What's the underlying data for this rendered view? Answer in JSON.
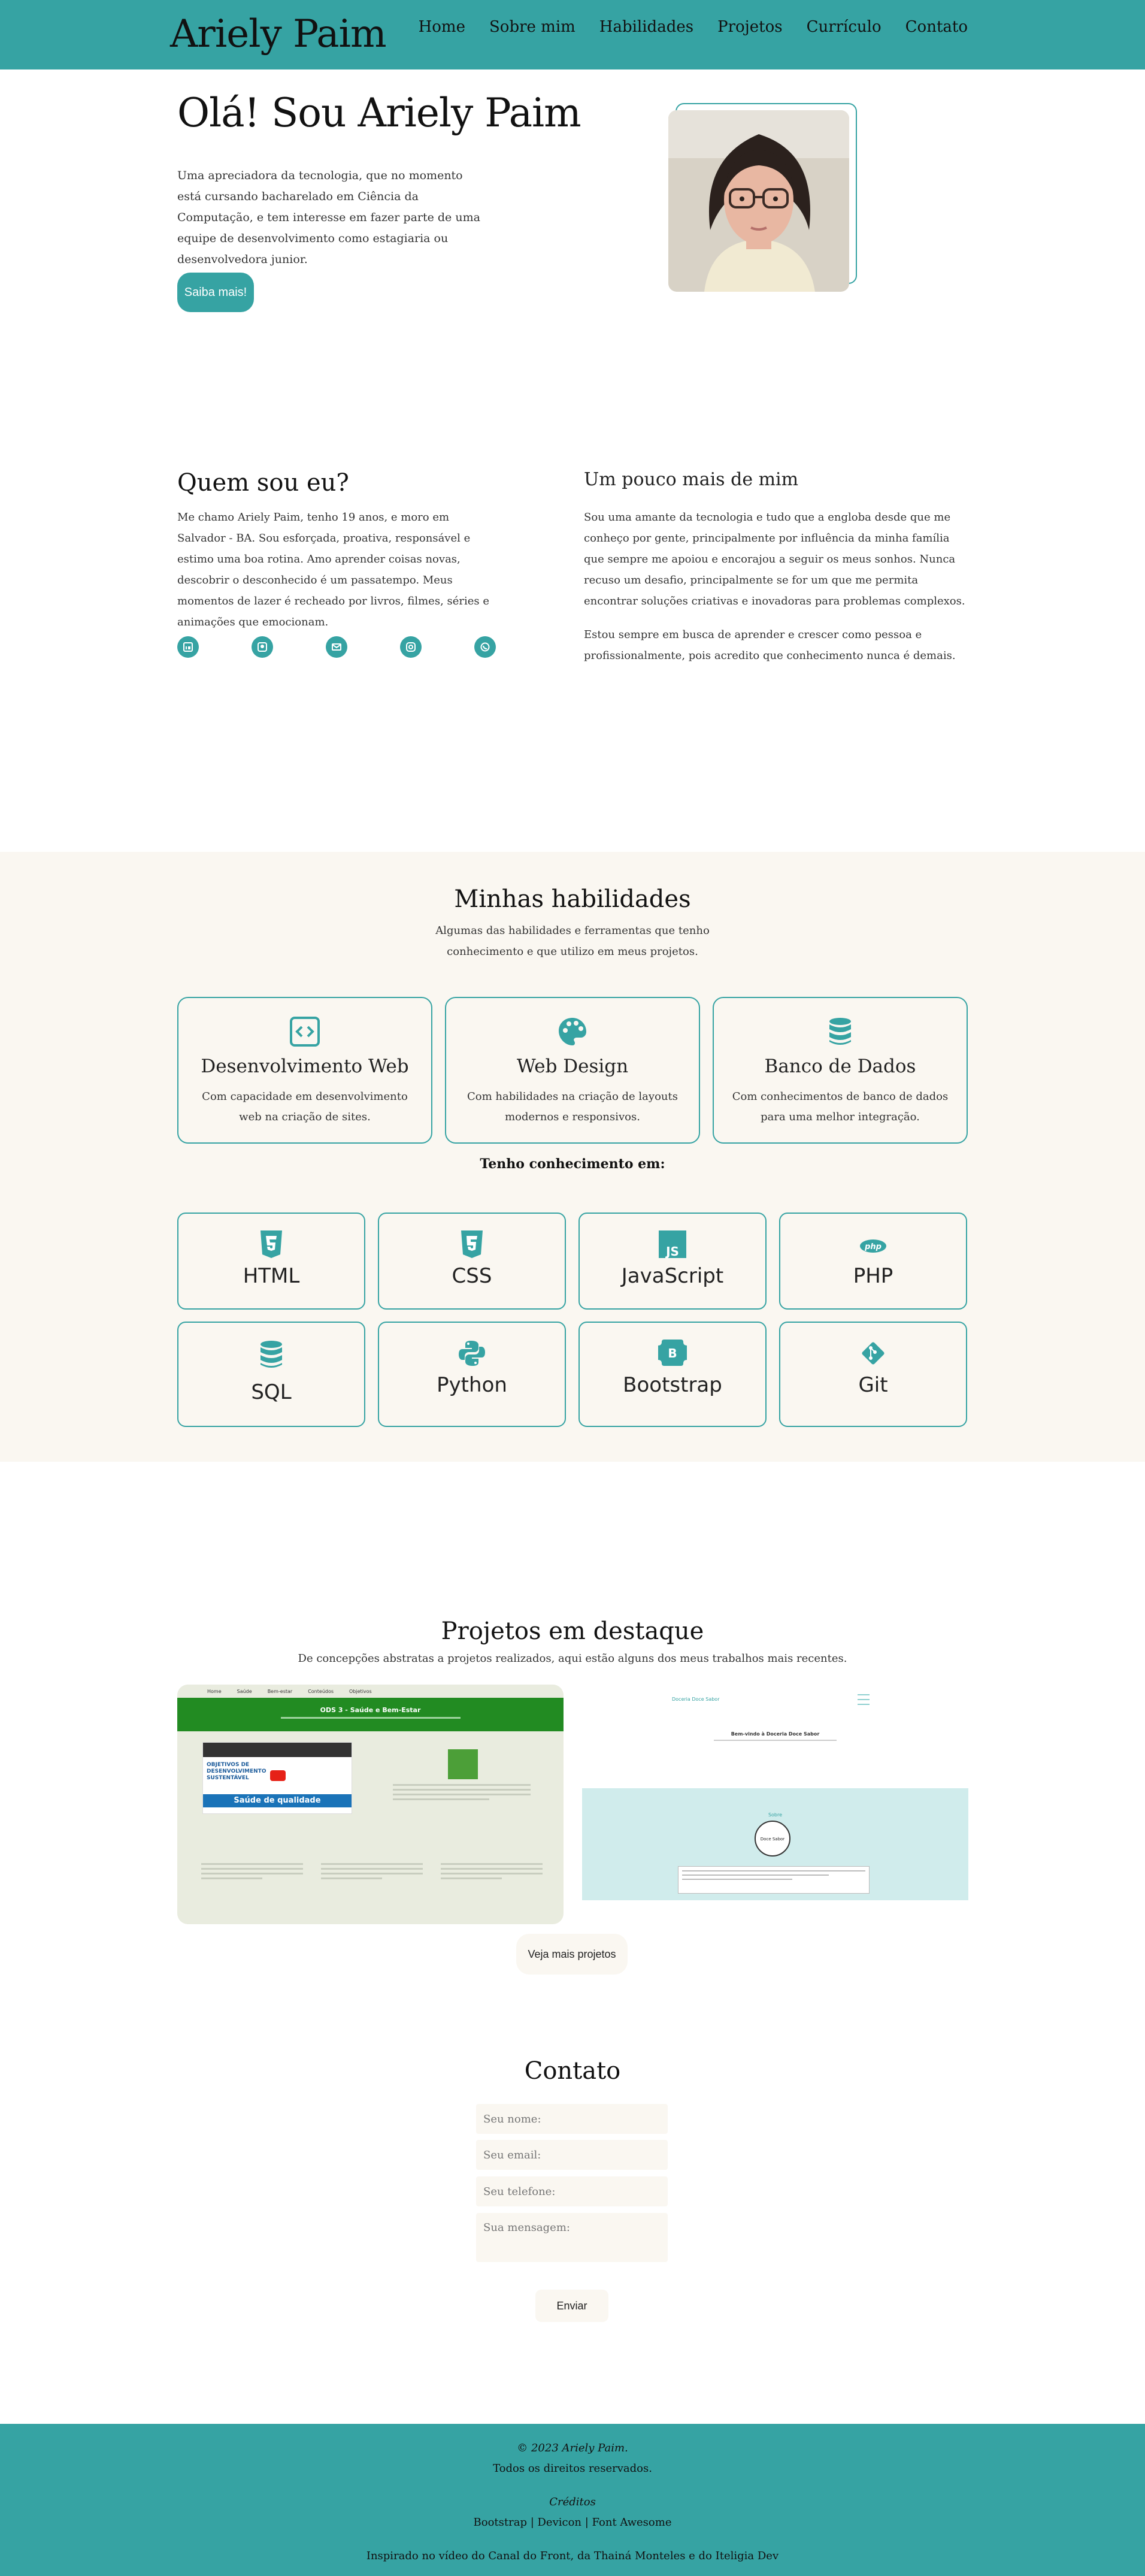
{
  "brand": "Ariely Paim",
  "nav": [
    "Home",
    "Sobre mim",
    "Habilidades",
    "Projetos",
    "Currículo",
    "Contato"
  ],
  "hero": {
    "title": "Olá! Sou Ariely Paim",
    "text": "Uma apreciadora da tecnologia, que no momento está cursando bacharelado em Ciência da Computação, e tem interesse em fazer parte de uma equipe de desenvolvimento como estagiaria ou desenvolvedora junior.",
    "button": "Saiba mais!"
  },
  "about": {
    "title": "Quem sou eu?",
    "text": "Me chamo Ariely Paim, tenho 19 anos, e moro em Salvador - BA. Sou esforçada, proativa, responsável e estimo uma boa rotina. Amo aprender coisas novas, descobrir o desconhecido é um passatempo. Meus momentos de lazer é recheado por livros, filmes, séries e animações que emocionam.",
    "social_icons": [
      "linkedin-icon",
      "github-icon",
      "email-icon",
      "instagram-icon",
      "whatsapp-icon"
    ],
    "more_title": "Um pouco mais de mim",
    "more_p1": "Sou uma amante da tecnologia e tudo que a engloba desde que me conheço por gente, principalmente por influência da minha família que sempre me apoiou e encorajou a seguir os meus sonhos. Nunca recuso um desafio, principalmente se for um que me permita encontrar soluções criativas e inovadoras para problemas complexos.",
    "more_p2": "Estou sempre em busca de aprender e crescer como pessoa e profissionalmente, pois acredito que conhecimento nunca é demais."
  },
  "skills": {
    "title": "Minhas habilidades",
    "subtitle": "Algumas das habilidades e ferramentas que tenho conhecimento e que utilizo em meus projetos.",
    "cards": [
      {
        "title": "Desenvolvimento Web",
        "text": "Com capacidade em desenvolvimento web na criação de sites."
      },
      {
        "title": "Web Design",
        "text": "Com habilidades na criação de layouts modernos e responsivos."
      },
      {
        "title": "Banco de Dados",
        "text": "Com conhecimentos de banco de dados para uma melhor integração."
      }
    ],
    "know_title": "Tenho conhecimento em:",
    "tech": [
      "HTML",
      "CSS",
      "JavaScript",
      "PHP",
      "SQL",
      "Python",
      "Bootstrap",
      "Git"
    ]
  },
  "projects": {
    "title": "Projetos em destaque",
    "subtitle": "De concepções abstratas a projetos realizados, aqui estão alguns dos meus trabalhos mais recentes.",
    "p1": {
      "nav": [
        "Home",
        "Saúde",
        "Bem-estar",
        "Conteúdos",
        "Objetivos"
      ],
      "heading": "ODS 3 - Saúde e Bem-Estar",
      "video": "Saúde de qualidade",
      "video_title": "OBJETIVOS DE DESENVOLVIMENTO SUSTENTÁVEL"
    },
    "p2": {
      "brand": "Doceria Doce Sabor",
      "welcome": "Bem-vindo à Doceria Doce Sabor",
      "section": "Sobre",
      "logo": "Doce Sabor"
    },
    "button": "Veja mais projetos"
  },
  "contact": {
    "title": "Contato",
    "name_ph": "Seu nome:",
    "email_ph": "Seu email:",
    "phone_ph": "Seu telefone:",
    "msg_ph": "Sua mensagem:",
    "button": "Enviar"
  },
  "footer": {
    "copyright": "© 2023 Ariely Paim.",
    "rights": "Todos os direitos reservados.",
    "credits_title": "Créditos",
    "credits": "Bootstrap | Devicon | Font Awesome",
    "inspired": "Inspirado no vídeo do Canal do Front, da Thainá Monteles e do Iteligia Dev"
  },
  "colors": {
    "accent": "#36a3a3",
    "cream": "#faf7f1"
  }
}
